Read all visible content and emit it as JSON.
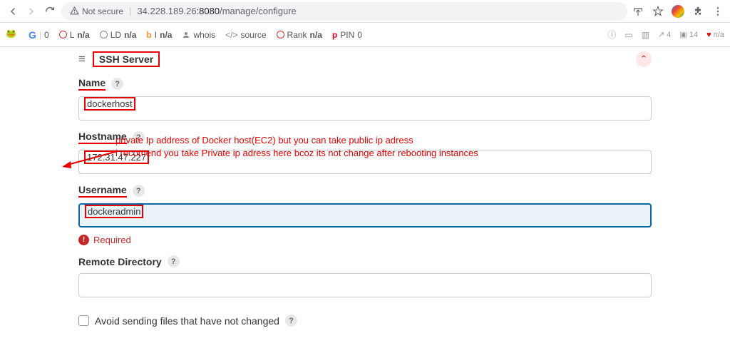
{
  "browser": {
    "security_text": "Not secure",
    "url_prefix": "34.228.189.26",
    "url_port": ":8080",
    "url_path": "/manage/configure"
  },
  "ext": {
    "g": "G",
    "g_val": "0",
    "l": "L",
    "na1": "n/a",
    "ld": "LD",
    "na2": "n/a",
    "i": "I",
    "na3": "n/a",
    "whois": "whois",
    "source": "source",
    "rank": "Rank",
    "na4": "n/a",
    "pin": "PIN",
    "pin_val": "0",
    "right1": "4",
    "right2": "14",
    "right3": "n/a"
  },
  "form": {
    "section_title": "SSH Server",
    "name_label": "Name",
    "name_value": "dockerhost",
    "hostname_label": "Hostname",
    "hostname_value": "172.31.47.227",
    "username_label": "Username",
    "username_value": "dockeradmin",
    "required_text": "Required",
    "remote_dir_label": "Remote Directory",
    "remote_dir_value": "",
    "avoid_label": "Avoid sending files that have not changed"
  },
  "annotation": {
    "line1": "private Ip address of Docker host(EC2) but you can take public ip adress",
    "line2": "i recomend you take Private ip adress here bcoz its not change after rebooting instances"
  }
}
